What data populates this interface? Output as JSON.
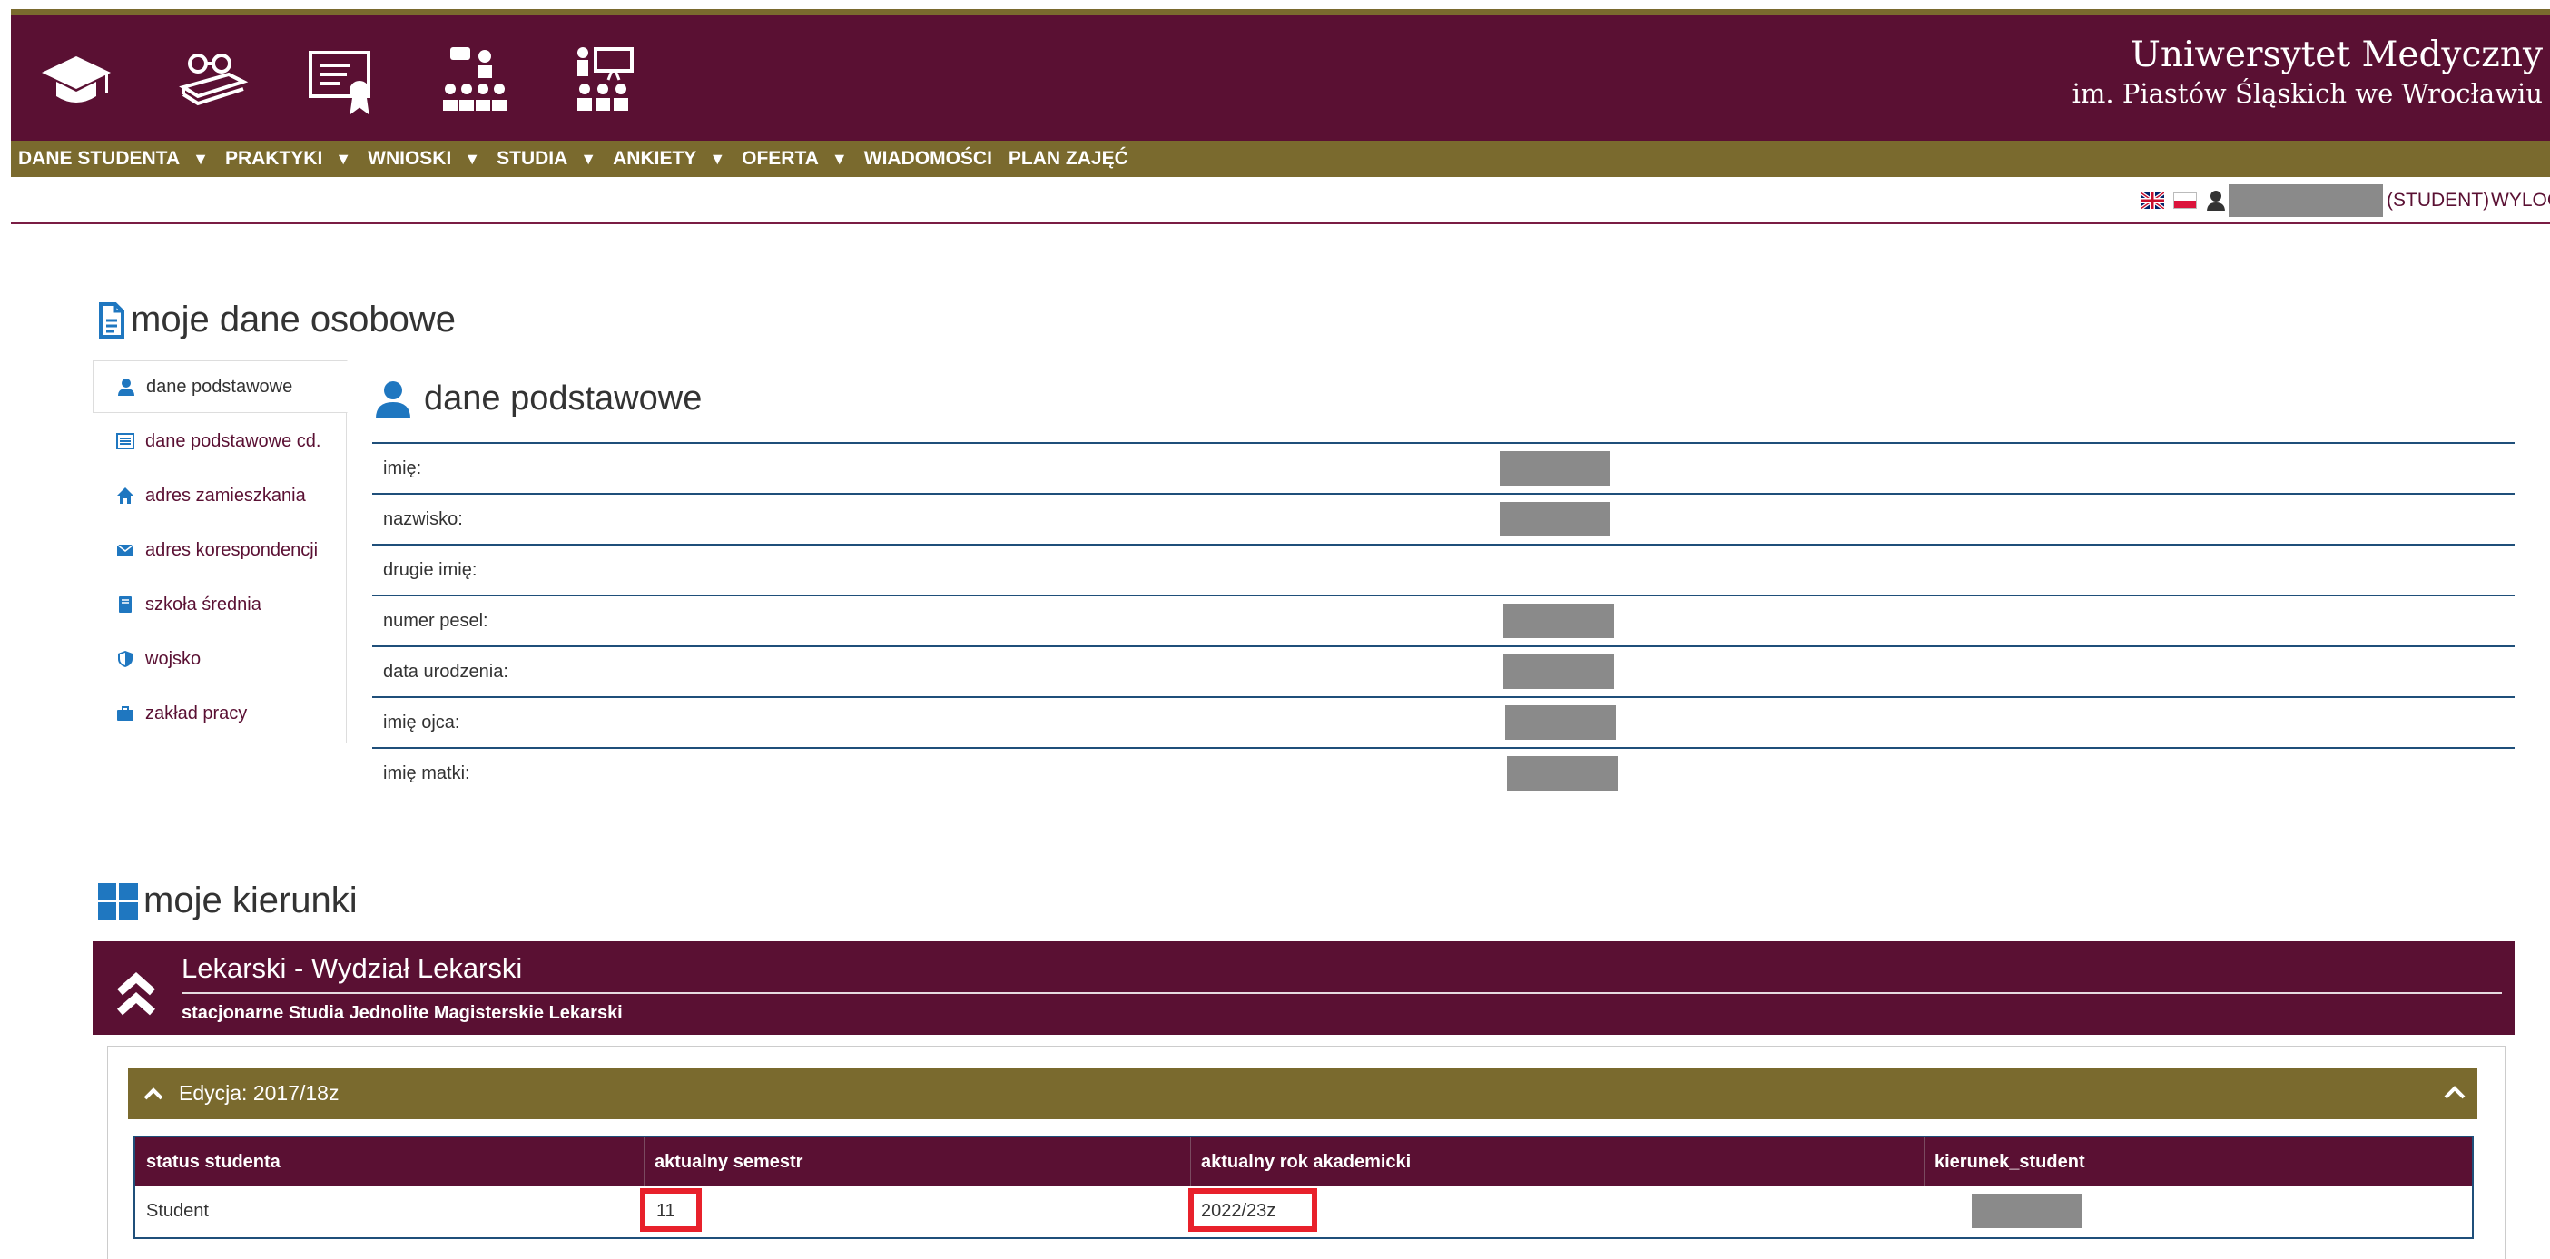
{
  "header": {
    "university_name": "Uniwersytet Medyczny",
    "university_subtitle": "im. Piastów Śląskich we Wrocławiu",
    "icons": [
      "graduation-cap-icon",
      "books-glasses-icon",
      "certificate-icon",
      "lecture-group-icon",
      "teacher-board-icon"
    ],
    "colors": {
      "primary": "#5a1033",
      "gold": "#7a6a2e"
    }
  },
  "nav": {
    "items": [
      {
        "label": "DANE STUDENTA",
        "dropdown": true
      },
      {
        "label": "PRAKTYKI",
        "dropdown": true
      },
      {
        "label": "WNIOSKI",
        "dropdown": true
      },
      {
        "label": "STUDIA",
        "dropdown": true
      },
      {
        "label": "ANKIETY",
        "dropdown": true
      },
      {
        "label": "OFERTA",
        "dropdown": true
      },
      {
        "label": "WIADOMOŚCI",
        "dropdown": false
      },
      {
        "label": "PLAN ZAJĘĆ",
        "dropdown": false
      }
    ],
    "dropdown_glyph": "▼"
  },
  "userbar": {
    "role": "(STUDENT)",
    "logout": "WYLOGU"
  },
  "personal": {
    "title": "moje dane osobowe",
    "menu": [
      {
        "label": "dane podstawowe",
        "icon": "user-icon"
      },
      {
        "label": "dane podstawowe cd.",
        "icon": "list-icon"
      },
      {
        "label": "adres zamieszkania",
        "icon": "home-icon"
      },
      {
        "label": "adres korespondencji",
        "icon": "envelope-icon"
      },
      {
        "label": "szkoła średnia",
        "icon": "book-icon"
      },
      {
        "label": "wojsko",
        "icon": "shield-icon"
      },
      {
        "label": "zakład pracy",
        "icon": "briefcase-icon"
      }
    ],
    "subtitle": "dane podstawowe",
    "fields": [
      {
        "label": "imię:",
        "redacted": true
      },
      {
        "label": "nazwisko:",
        "redacted": true
      },
      {
        "label": "drugie imię:",
        "redacted": false
      },
      {
        "label": "numer pesel:",
        "redacted": true
      },
      {
        "label": "data urodzenia:",
        "redacted": true
      },
      {
        "label": "imię ojca:",
        "redacted": true
      },
      {
        "label": "imię matki:",
        "redacted": true
      }
    ]
  },
  "kierunki": {
    "title": "moje kierunki",
    "name": "Lekarski - Wydział Lekarski",
    "subtitle": "stacjonarne Studia Jednolite Magisterskie Lekarski",
    "edycja": "Edycja: 2017/18z",
    "table": {
      "headers": [
        "status studenta",
        "aktualny semestr",
        "aktualny rok akademicki",
        "kierunek_student"
      ],
      "row": [
        "Student",
        "11",
        "2022/23z",
        ""
      ]
    },
    "highlight_color": "#e8212b"
  }
}
